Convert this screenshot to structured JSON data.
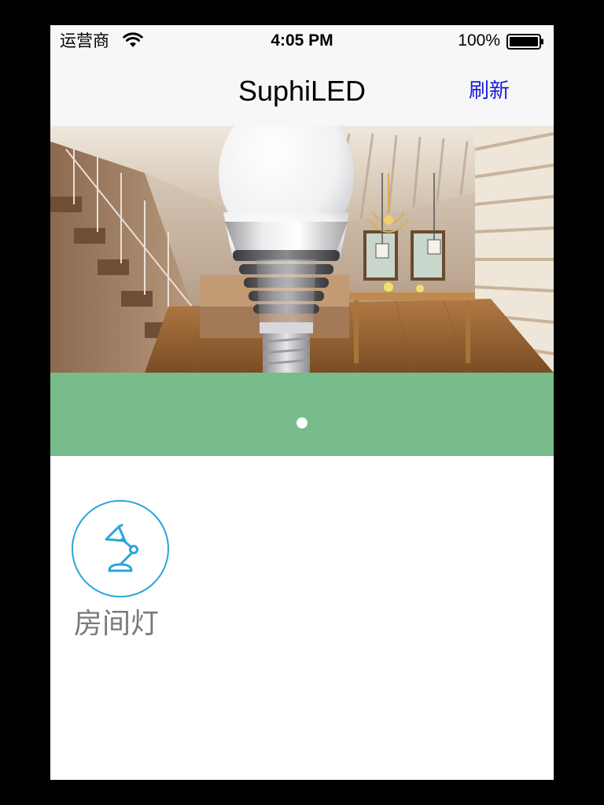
{
  "status_bar": {
    "carrier": "运营商",
    "time": "4:05 PM",
    "battery": "100%"
  },
  "nav": {
    "title": "SuphiLED",
    "refresh_label": "刷新"
  },
  "banner": {
    "image": "led-bulb-interior-photo",
    "pages": 1,
    "current_page": 1
  },
  "devices": [
    {
      "label": "房间灯",
      "icon": "desk-lamp-icon"
    }
  ],
  "colors": {
    "pager_bg": "#77bc8a",
    "device_ring": "#2aa6d8",
    "nav_link": "#1a1adc",
    "label_text": "#7a7a7a"
  }
}
